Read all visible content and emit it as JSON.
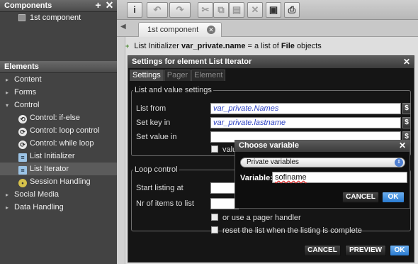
{
  "sidebar": {
    "components_title": "Components",
    "components": [
      "1st component"
    ],
    "elements_title": "Elements",
    "tree": [
      {
        "label": "Content",
        "type": "folder"
      },
      {
        "label": "Forms",
        "type": "folder"
      },
      {
        "label": "Control",
        "type": "folder-open"
      },
      {
        "label": "Control: if-else",
        "type": "item",
        "icon": "if-else-icon"
      },
      {
        "label": "Control: loop control",
        "type": "item",
        "icon": "loop-icon"
      },
      {
        "label": "Control: while loop",
        "type": "item",
        "icon": "loop-icon"
      },
      {
        "label": "List Initializer",
        "type": "item",
        "icon": "list-icon"
      },
      {
        "label": "List Iterator",
        "type": "item",
        "icon": "list-icon",
        "selected": true
      },
      {
        "label": "Session Handling",
        "type": "item",
        "icon": "session-icon"
      },
      {
        "label": "Social Media",
        "type": "folder"
      },
      {
        "label": "Data Handling",
        "type": "folder"
      }
    ]
  },
  "toolbar": {
    "info_icon": "i",
    "undo_icon": "↶",
    "redo_icon": "↷",
    "cut_icon": "✂",
    "copy_icon": "⧉",
    "paste_icon": "▤",
    "delete_icon": "✕",
    "save_icon": "▣",
    "preview_icon": "⎙"
  },
  "tabs": {
    "active": "1st component"
  },
  "content": {
    "list_initializer_prefix": "List Initializer",
    "list_initializer_var": "var_private.name",
    "list_initializer_mid": "= a list of",
    "list_initializer_type": "File",
    "list_initializer_suffix": "objects"
  },
  "settings_dialog": {
    "title": "Settings for element List Iterator",
    "tabs": [
      "Settings",
      "Pager",
      "Element"
    ],
    "group1_title": "List and value settings",
    "list_from_label": "List from",
    "list_from_value": "var_private.Names",
    "set_key_label": "Set key in",
    "set_key_value": "var_private.lastname",
    "set_value_label": "Set value in",
    "set_value_value": "",
    "value_checkbox_label": "value",
    "group2_title": "Loop control",
    "start_label": "Start listing at",
    "nr_items_label": "Nr of items to list",
    "pager_checkbox_label": "or use a pager handler",
    "reset_checkbox_label": "reset the list when the listing is complete",
    "cancel": "CANCEL",
    "preview": "PREVIEW",
    "ok": "OK",
    "dollar": "$"
  },
  "choose_variable": {
    "title": "Choose variable",
    "select_value": "Private variables",
    "variable_label": "Variable:",
    "variable_value": "sofiname",
    "cancel": "CANCEL",
    "ok": "OK"
  }
}
